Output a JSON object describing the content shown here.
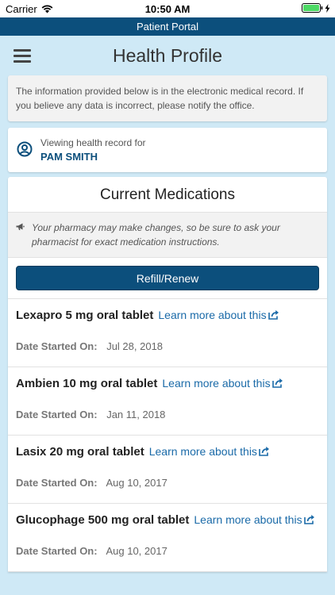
{
  "status_bar": {
    "carrier": "Carrier",
    "time": "10:50 AM"
  },
  "portal": {
    "title": "Patient Portal"
  },
  "header": {
    "title": "Health Profile"
  },
  "info_notice": "The information provided below is in the electronic medical record. If you believe any data is incorrect, please notify the office.",
  "patient": {
    "label": "Viewing health record for",
    "name": "PAM SMITH"
  },
  "medications": {
    "title": "Current Medications",
    "pharmacy_note": "Your pharmacy may make changes, so be sure to ask your pharmacist for exact medication instructions.",
    "refill_label": "Refill/Renew",
    "date_label": "Date Started On:",
    "learn_more_label": "Learn more about this",
    "items": [
      {
        "name": "Lexapro 5 mg oral tablet",
        "date": "Jul 28, 2018"
      },
      {
        "name": "Ambien 10 mg oral tablet",
        "date": "Jan 11, 2018"
      },
      {
        "name": "Lasix 20 mg oral tablet",
        "date": "Aug 10, 2017"
      },
      {
        "name": "Glucophage 500 mg oral tablet",
        "date": "Aug 10, 2017"
      }
    ]
  },
  "colors": {
    "brand": "#0c4f7c",
    "link": "#1a6aa8",
    "background": "#cfe9f6",
    "battery": "#4cd964"
  }
}
